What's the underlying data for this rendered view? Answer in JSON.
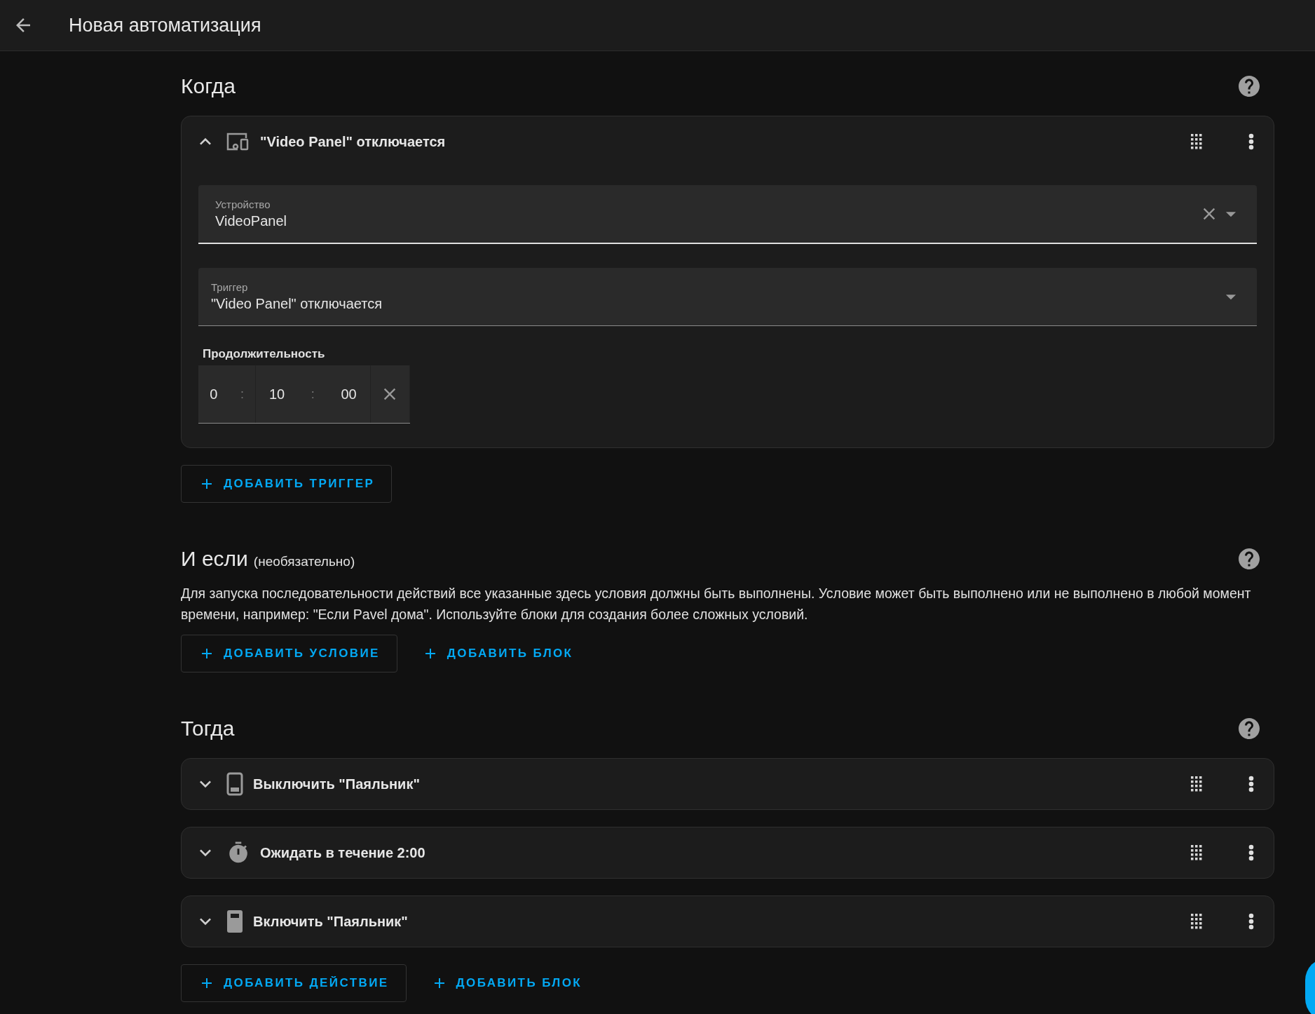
{
  "header": {
    "title": "Новая автоматизация"
  },
  "sections": [
    {
      "title": "Когда",
      "cards": [
        {
          "kind": "device",
          "title": "\"Video Panel\" отключается",
          "expanded": true,
          "device_field": {
            "label": "Устройство",
            "value": "VideoPanel"
          },
          "trigger_field": {
            "label": "Триггер",
            "value": "\"Video Panel\" отключается"
          },
          "duration": {
            "label": "Продолжительность",
            "hours": "0",
            "minutes": "10",
            "seconds": "00",
            "separator": ":"
          }
        }
      ],
      "buttons": [
        {
          "label": "ДОБАВИТЬ ТРИГГЕР",
          "outlined": true
        }
      ]
    },
    {
      "title": "И если",
      "suffix": "(необязательно)",
      "description": "Для запуска последовательности действий все указанные здесь условия должны быть выполнены. Условие может быть выполнено или не выполнено в любой момент времени, например: \"Если Pavel дома\". Используйте блоки для создания более сложных условий.",
      "buttons": [
        {
          "label": "ДОБАВИТЬ УСЛОВИЕ",
          "outlined": true
        },
        {
          "label": "ДОБАВИТЬ БЛОК",
          "outlined": false
        }
      ]
    },
    {
      "title": "Тогда",
      "cards": [
        {
          "kind": "switch-off",
          "title": "Выключить \"Паяльник\"",
          "expanded": false
        },
        {
          "kind": "timer",
          "title": "Ожидать в течение 2:00",
          "expanded": false
        },
        {
          "kind": "switch-on",
          "title": "Включить \"Паяльник\"",
          "expanded": false
        }
      ],
      "buttons": [
        {
          "label": "ДОБАВИТЬ ДЕЙСТВИЕ",
          "outlined": true
        },
        {
          "label": "ДОБАВИТЬ БЛОК",
          "outlined": false
        }
      ]
    }
  ]
}
